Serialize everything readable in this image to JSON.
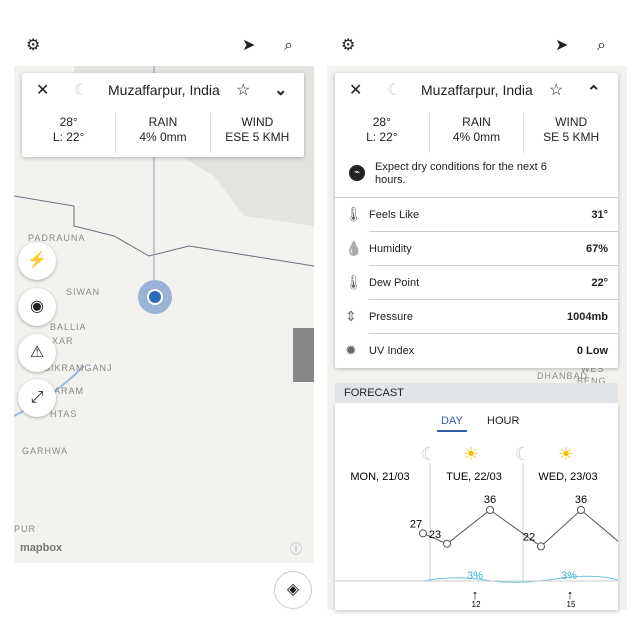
{
  "left": {
    "icons": {
      "settings": "gear-icon",
      "locate": "location-arrow-icon",
      "search": "search-icon"
    },
    "card": {
      "title": "Muzaffarpur, India",
      "temp": "28°",
      "low": "L: 22°",
      "rain_label": "RAIN",
      "rain": "4% 0mm",
      "wind_label": "WIND",
      "wind": "ESE 5 KMH"
    },
    "map_labels": [
      "PADRAUNA",
      "SIWAN",
      "BALLIA",
      "XAR",
      "SIKRAMGANJ",
      "ARAM",
      "HTAS",
      "GARHWA",
      "PUR"
    ],
    "attribution": "mapbox",
    "fabs": [
      "lightning-icon",
      "radar-icon",
      "warning-icon",
      "expand-icon"
    ]
  },
  "right": {
    "card": {
      "title": "Muzaffarpur, India",
      "temp": "28°",
      "low": "L: 22°",
      "rain_label": "RAIN",
      "rain": "4% 0mm",
      "wind_label": "WIND",
      "wind": "SE 5 KMH",
      "summary": "Expect dry conditions for the next 6 hours.",
      "details": [
        {
          "label": "Feels Like",
          "value": "31°",
          "icon": "thermometer-icon"
        },
        {
          "label": "Humidity",
          "value": "67%",
          "icon": "droplet-icon"
        },
        {
          "label": "Dew Point",
          "value": "22°",
          "icon": "thermometer-low-icon"
        },
        {
          "label": "Pressure",
          "value": "1004mb",
          "icon": "pressure-icon"
        },
        {
          "label": "UV Index",
          "value": "0 Low",
          "icon": "sun-burst-icon"
        }
      ]
    },
    "map_labels": [
      "DHANBAD",
      "WES",
      "BENG"
    ],
    "forecast": {
      "header": "FORECAST",
      "tabs": [
        "DAY",
        "HOUR"
      ],
      "active_tab": "DAY",
      "days": [
        "MON, 21/03",
        "TUE, 22/03",
        "WED, 23/03"
      ],
      "temps": [
        27,
        23,
        36,
        22,
        36
      ],
      "rain": [
        "3%",
        "3%"
      ],
      "wind": [
        "12",
        "15"
      ]
    }
  }
}
